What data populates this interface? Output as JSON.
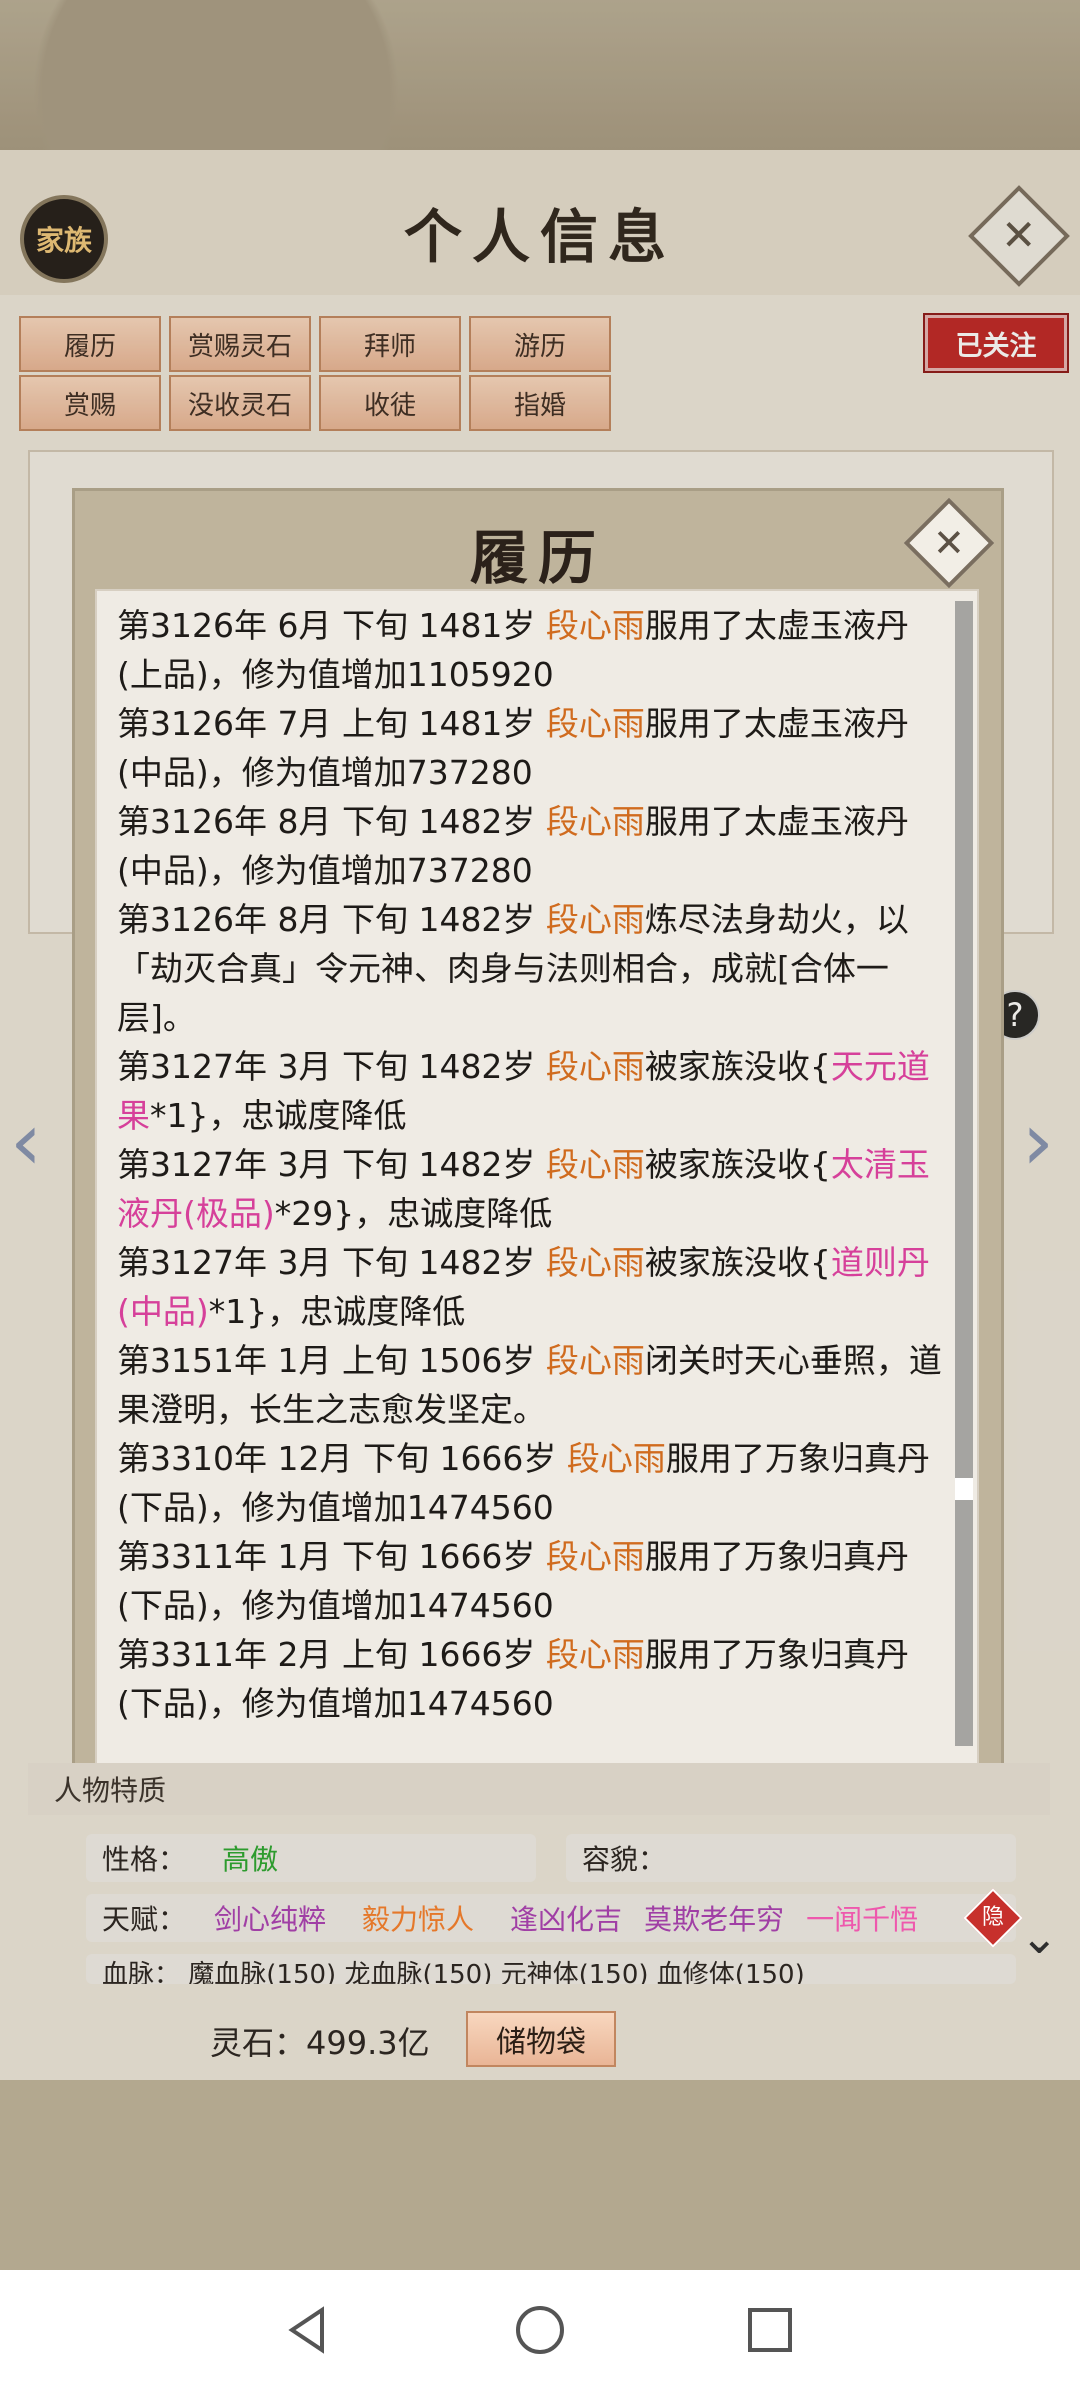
{
  "header": {
    "title": "个人信息",
    "family_label": "家族",
    "close_symbol": "✕"
  },
  "tabs": [
    "履历",
    "赏赐灵石",
    "拜师",
    "游历",
    "赏赐",
    "没收灵石",
    "收徒",
    "指婚"
  ],
  "followed_label": "已关注",
  "record_modal": {
    "title": "履历",
    "close_symbol": "✕",
    "records": [
      {
        "prefix": "第3126年 6月 下旬 1481岁 ",
        "name": "段心雨",
        "mid": "服用了太虚玉液丹(上品)，修为值增加1105920",
        "item": "",
        "suffix": ""
      },
      {
        "prefix": "第3126年 7月 上旬 1481岁 ",
        "name": "段心雨",
        "mid": "服用了太虚玉液丹(中品)，修为值增加737280",
        "item": "",
        "suffix": ""
      },
      {
        "prefix": "第3126年 8月 下旬 1482岁 ",
        "name": "段心雨",
        "mid": "服用了太虚玉液丹(中品)，修为值增加737280",
        "item": "",
        "suffix": ""
      },
      {
        "prefix": "第3126年 8月 下旬 1482岁 ",
        "name": "段心雨",
        "mid": "炼尽法身劫火，以「劫灭合真」令元神、肉身与法则相合，成就[合体一层]。",
        "item": "",
        "suffix": ""
      },
      {
        "prefix": "第3127年 3月 下旬 1482岁 ",
        "name": "段心雨",
        "mid": "被家族没收{",
        "item": "天元道果",
        "suffix": "*1}，忠诚度降低"
      },
      {
        "prefix": "第3127年 3月 下旬 1482岁 ",
        "name": "段心雨",
        "mid": "被家族没收{",
        "item": "太清玉液丹(极品)",
        "suffix": "*29}，忠诚度降低"
      },
      {
        "prefix": "第3127年 3月 下旬 1482岁 ",
        "name": "段心雨",
        "mid": "被家族没收{",
        "item": "道则丹(中品)",
        "suffix": "*1}，忠诚度降低"
      },
      {
        "prefix": "第3151年 1月 上旬 1506岁 ",
        "name": "段心雨",
        "mid": "闭关时天心垂照，道果澄明，长生之志愈发坚定。",
        "item": "",
        "suffix": ""
      },
      {
        "prefix": "第3310年 12月 下旬 1666岁 ",
        "name": "段心雨",
        "mid": "服用了万象归真丹(下品)，修为值增加1474560",
        "item": "",
        "suffix": ""
      },
      {
        "prefix": "第3311年 1月 下旬 1666岁 ",
        "name": "段心雨",
        "mid": "服用了万象归真丹(下品)，修为值增加1474560",
        "item": "",
        "suffix": ""
      },
      {
        "prefix": "第3311年 2月 上旬 1666岁 ",
        "name": "段心雨",
        "mid": "服用了万象归真丹(下品)，修为值增加1474560",
        "item": "",
        "suffix": ""
      }
    ]
  },
  "traits_section": {
    "title": "人物特质",
    "personality_label": "性格：",
    "personality_value": "高傲",
    "appearance_label": "容貌：",
    "talent_label": "天赋：",
    "talents": [
      "剑心纯粹",
      "毅力惊人",
      "逢凶化吉",
      "莫欺老年穷",
      "一闻千悟"
    ],
    "hide_label": "隐",
    "bloodline_text": "血脉：  魔血脉(150)  龙血脉(150)  元神体(150)  血修体(150)"
  },
  "footer": {
    "stone_label": "灵石：499.3亿",
    "bag_button": "储物袋"
  },
  "colors": {
    "name": "#d06b1e",
    "item": "#d6409a",
    "followed": "#bf2323",
    "tab_bg": "#f2c6a8"
  }
}
